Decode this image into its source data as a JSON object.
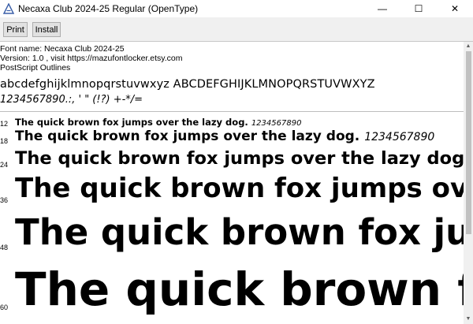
{
  "window": {
    "title": "Necaxa Club 2024-25 Regular (OpenType)",
    "minimize": "—",
    "maximize": "☐",
    "close": "✕"
  },
  "toolbar": {
    "print_label": "Print",
    "install_label": "Install"
  },
  "info": {
    "font_name": "Font name: Necaxa Club 2024-25",
    "version": "Version: 1.0 , visit https://mazufontlocker.etsy.com",
    "outlines": "PostScript Outlines"
  },
  "glyphs": {
    "letters": "abcdefghijklmnopqrstuvwxyz ABCDEFGHIJKLMNOPQRSTUVWXYZ",
    "symbols": "1234567890.:, ' \" (!?) +-*/="
  },
  "samples": [
    {
      "size": "12",
      "text": "The quick brown fox jumps over the lazy dog.",
      "digits": "1234567890"
    },
    {
      "size": "18",
      "text": "The quick brown fox jumps over the lazy dog.",
      "digits": "1234567890"
    },
    {
      "size": "24",
      "text": "The quick brown fox jumps over the lazy dog.",
      "digits": ""
    },
    {
      "size": "36",
      "text": "The quick brown fox jumps ov",
      "digits": ""
    },
    {
      "size": "48",
      "text": "The quick brown fox ju",
      "digits": ""
    },
    {
      "size": "60",
      "text": "The quick brown fo",
      "digits": ""
    }
  ]
}
